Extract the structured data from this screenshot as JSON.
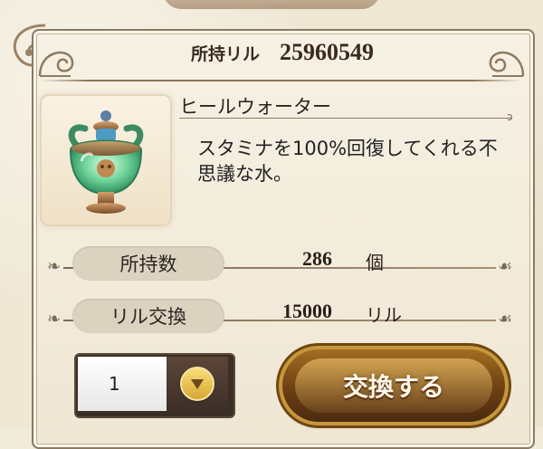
{
  "header": {
    "balance_label": "所持リル",
    "balance_value": "25960549"
  },
  "item": {
    "name": "ヒールウォーター",
    "description": "スタミナを100%回復してくれる不思議な水。",
    "icon": "heal-water-vase-icon"
  },
  "stats": {
    "owned": {
      "label": "所持数",
      "value": "286",
      "unit": "個"
    },
    "exchange_rate": {
      "label": "リル交換",
      "value": "15000",
      "unit": "リル"
    }
  },
  "quantity": {
    "value": "1",
    "dropdown_icon": "chevron-down-circle-icon"
  },
  "actions": {
    "exchange_label": "交換する"
  },
  "colors": {
    "text_dark": "#3a2a1f",
    "panel_border": "#8a7a63",
    "button_gold": "#c7983b",
    "button_brown": "#6d3f13"
  }
}
